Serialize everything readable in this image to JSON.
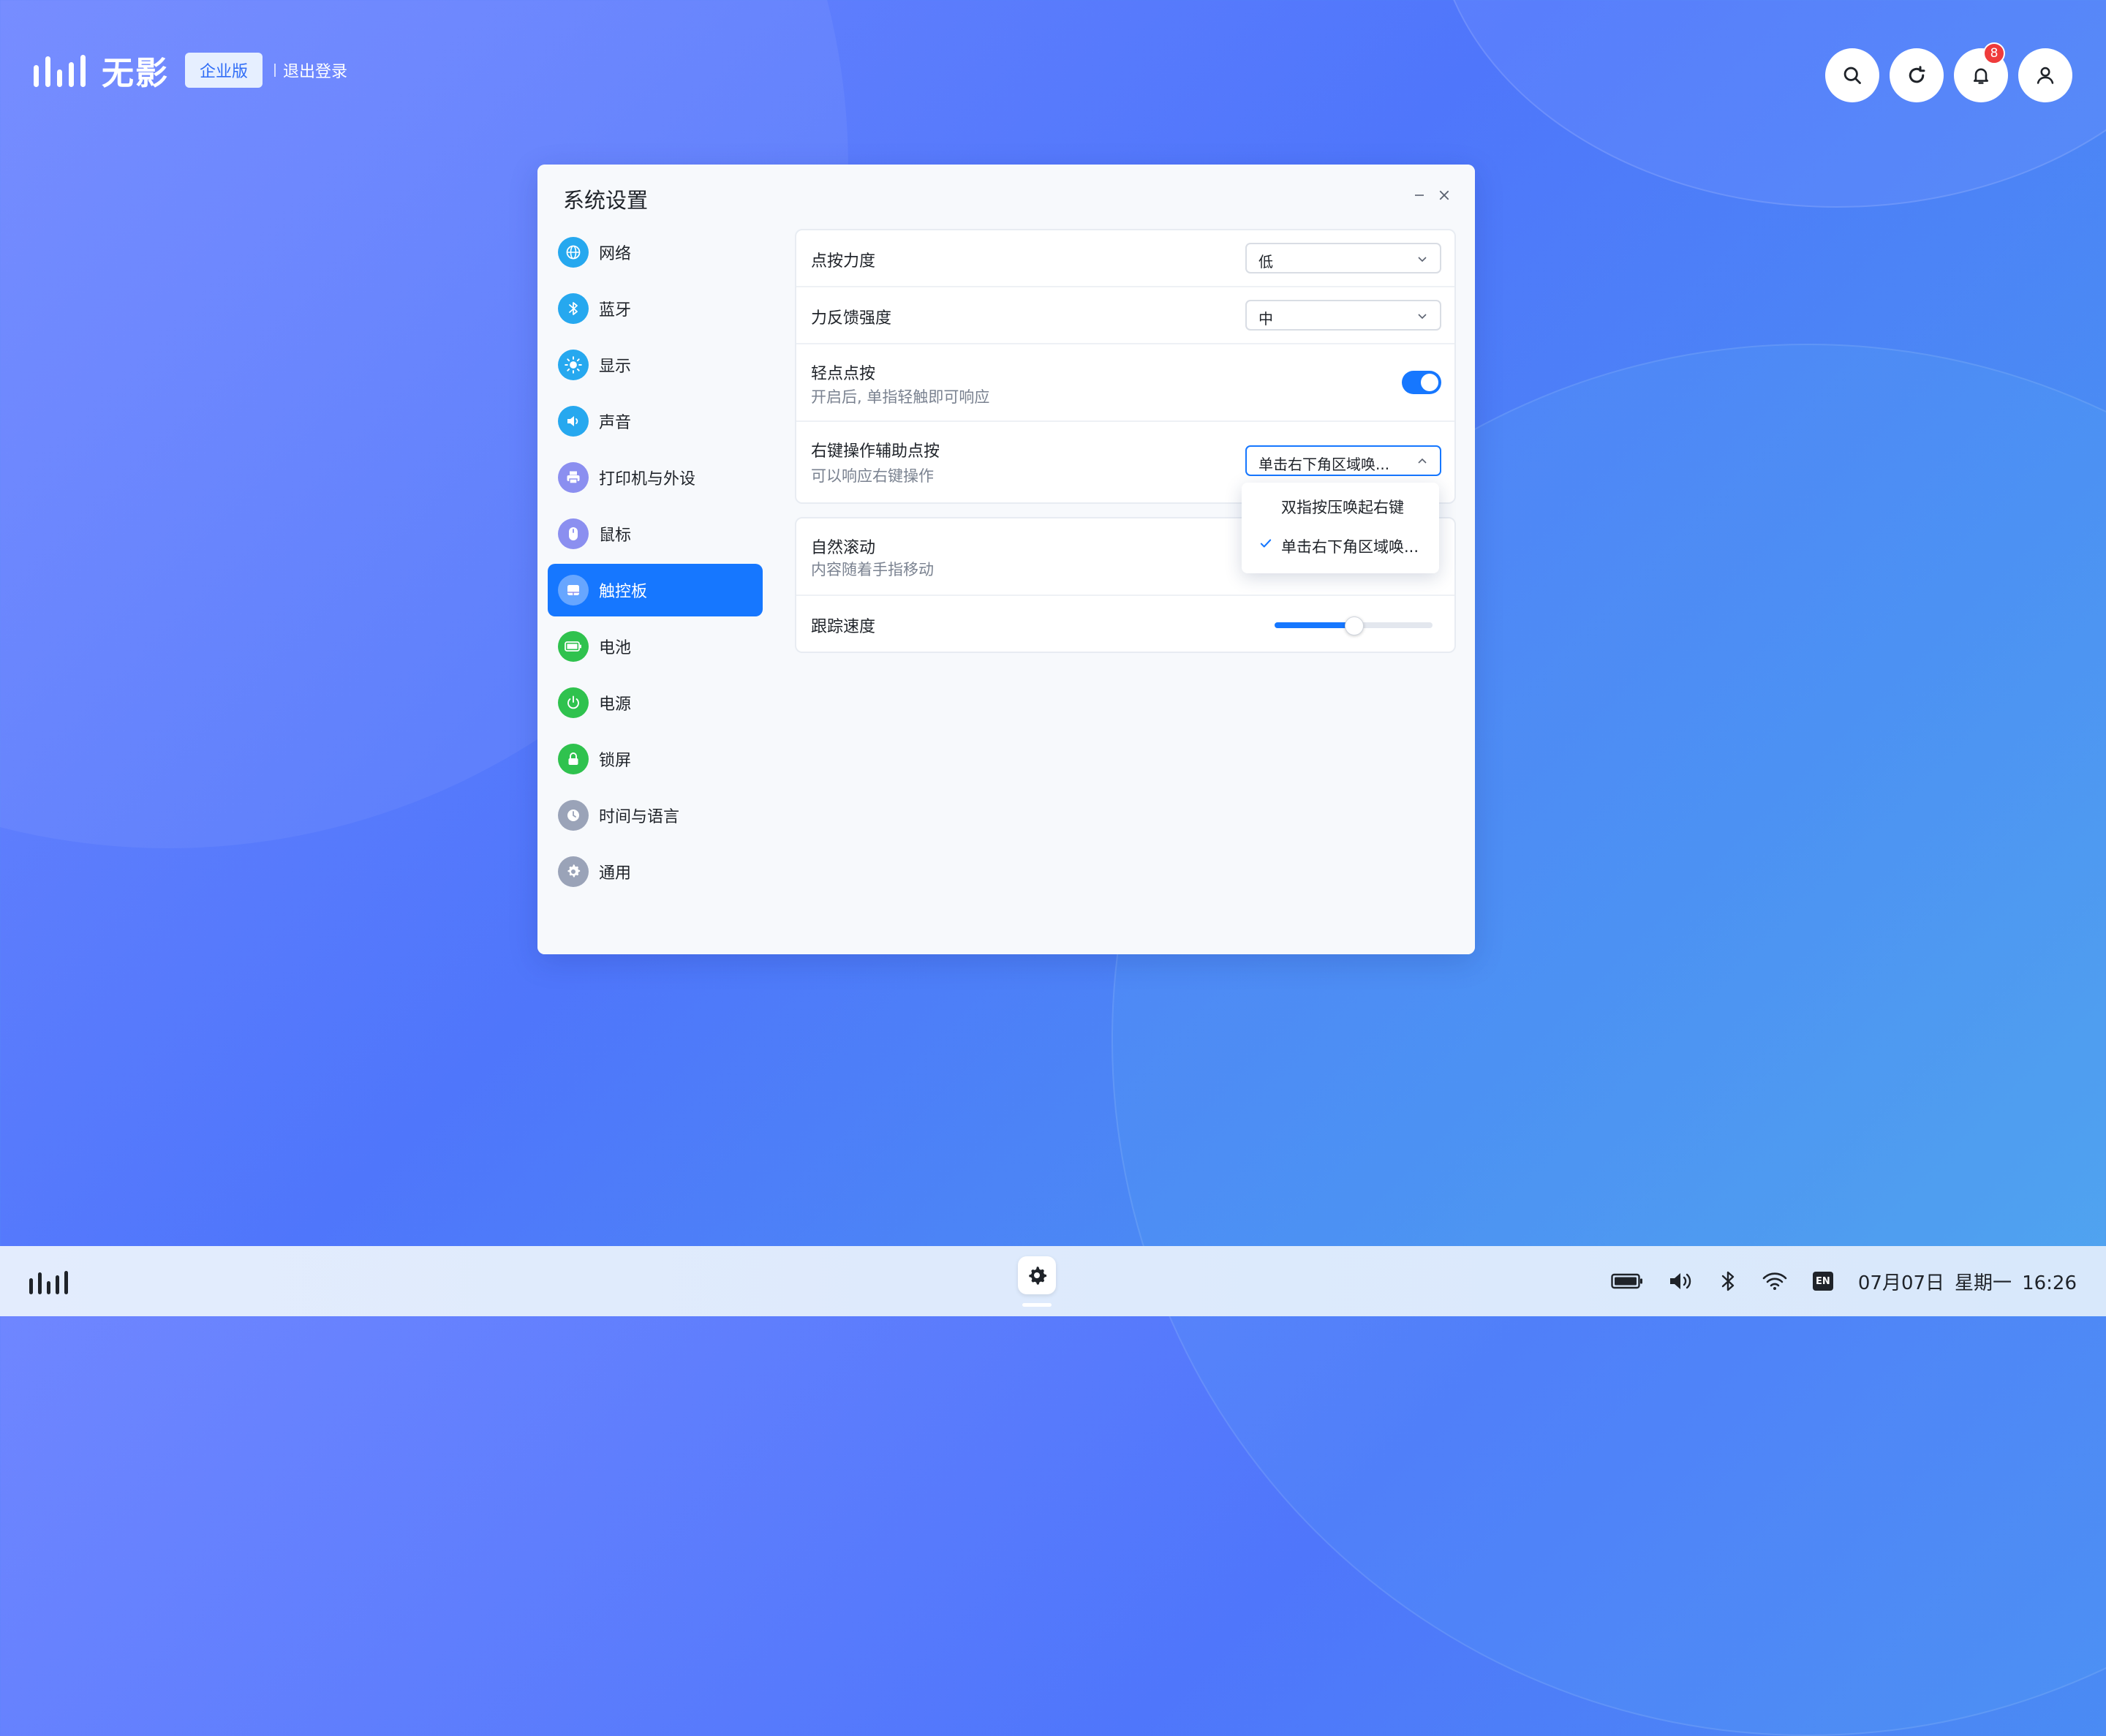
{
  "brand": {
    "name": "无影",
    "edition": "企业版",
    "logout": "退出登录"
  },
  "top_icons": {
    "notification_count": "8"
  },
  "window": {
    "title": "系统设置",
    "sidebar": {
      "items": [
        {
          "label": "网络",
          "icon": "globe-icon",
          "color": "#26a8ef"
        },
        {
          "label": "蓝牙",
          "icon": "bluetooth-icon",
          "color": "#26a8ef"
        },
        {
          "label": "显示",
          "icon": "brightness-icon",
          "color": "#26a8ef"
        },
        {
          "label": "声音",
          "icon": "speaker-icon",
          "color": "#26a8ef"
        },
        {
          "label": "打印机与外设",
          "icon": "printer-icon",
          "color": "#8b8ff0"
        },
        {
          "label": "鼠标",
          "icon": "mouse-icon",
          "color": "#8b8ff0"
        },
        {
          "label": "触控板",
          "icon": "touchpad-icon",
          "color": "#8b8ff0",
          "active": true
        },
        {
          "label": "电池",
          "icon": "battery-icon",
          "color": "#2fc24e"
        },
        {
          "label": "电源",
          "icon": "power-icon",
          "color": "#2fc24e"
        },
        {
          "label": "锁屏",
          "icon": "lock-icon",
          "color": "#2fc24e"
        },
        {
          "label": "时间与语言",
          "icon": "clock-icon",
          "color": "#9aa3b8"
        },
        {
          "label": "通用",
          "icon": "gear-icon",
          "color": "#9aa3b8"
        }
      ]
    },
    "settings": {
      "click_force": {
        "label": "点按力度",
        "value": "低"
      },
      "feedback_strength": {
        "label": "力反馈强度",
        "value": "中"
      },
      "tap_to_click": {
        "label": "轻点点按",
        "sub": "开启后, 单指轻触即可响应",
        "on": true
      },
      "right_click_assist": {
        "label": "右键操作辅助点按",
        "sub": "可以响应右键操作",
        "value": "单击右下角区域唤..."
      },
      "natural_scroll": {
        "label": "自然滚动",
        "sub": "内容随着手指移动"
      },
      "tracking_speed": {
        "label": "跟踪速度",
        "value_percent": 50
      }
    },
    "dropdown": {
      "options": [
        {
          "label": "双指按压唤起右键",
          "selected": false
        },
        {
          "label": "单击右下角区域唤...",
          "selected": true
        }
      ]
    }
  },
  "taskbar": {
    "input_method": "EN",
    "date": "07月07日",
    "weekday": "星期一",
    "time": "16:26"
  },
  "colors": {
    "accent": "#1677ff",
    "badge": "#ef3b3b"
  }
}
